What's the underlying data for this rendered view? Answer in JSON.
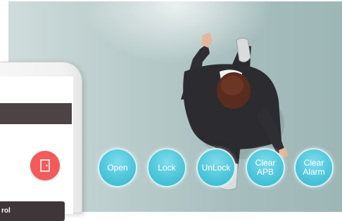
{
  "phone": {
    "control_label": "rol",
    "accent_color": "#f25b59",
    "icon": "door-icon"
  },
  "actions": {
    "open": "Open",
    "lock": "Lock",
    "unlock": "UnLock",
    "clear_apb": "Clear\nAPB",
    "clear_alarm": "Clear\nAlarm"
  },
  "colors": {
    "action_button": "#4fc6db",
    "background": "#b9cccb"
  }
}
